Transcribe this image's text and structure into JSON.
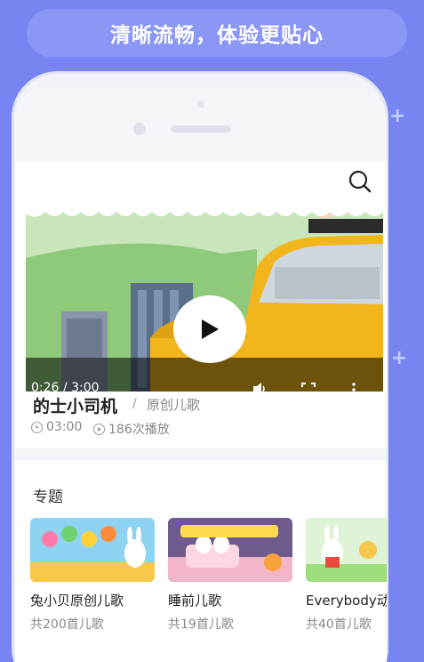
{
  "banner": {
    "text": "清晰流畅，体验更贴心"
  },
  "player": {
    "current_time": "0:26",
    "time_sep": " / ",
    "duration": "3:00",
    "progress_fraction": 0.144
  },
  "song": {
    "title": "的士小司机",
    "separator": "/",
    "category": "原创儿歌",
    "length": "03:00",
    "plays": "186次播放"
  },
  "section": {
    "title": "专题"
  },
  "topics": [
    {
      "name": "兔小贝原创儿歌",
      "count": "共200首儿歌"
    },
    {
      "name": "睡前儿歌",
      "count": "共19首儿歌"
    },
    {
      "name": "Everybody动",
      "count": "共40首儿歌"
    }
  ],
  "colors": {
    "background": "#7784f2",
    "banner": "#8b97f5",
    "taxi": "#f2b51c"
  }
}
